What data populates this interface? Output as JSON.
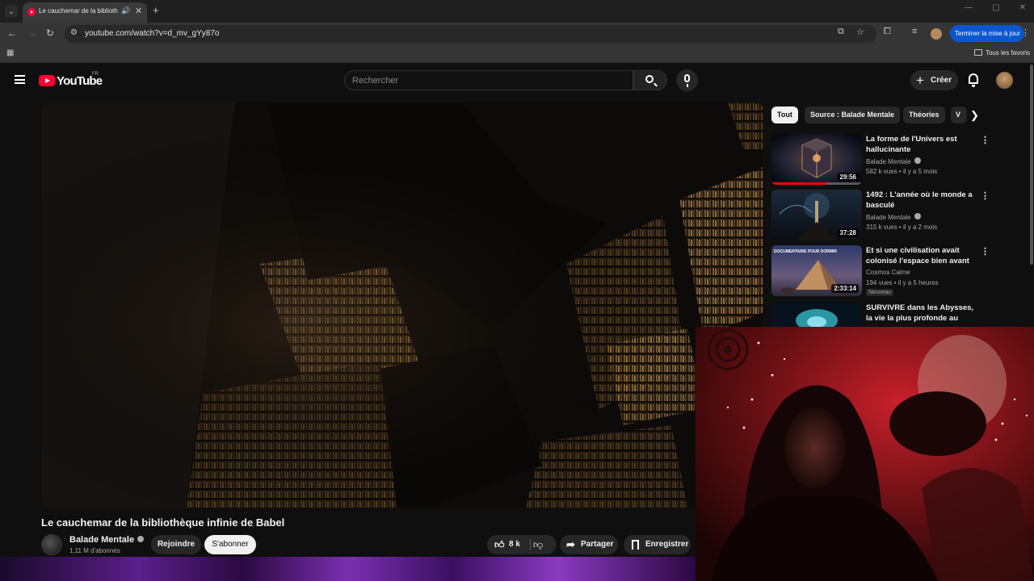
{
  "browser": {
    "tab_title": "Le cauchemar de la biblioth",
    "url": "youtube.com/watch?v=d_mv_gYy87o",
    "update_label": "Terminer la mise à jour",
    "all_favorites_label": "Tous les favoris"
  },
  "header": {
    "logo_text": "YouTube",
    "country_code": "FR",
    "search_placeholder": "Rechercher",
    "create_label": "Créer"
  },
  "video": {
    "title": "Le cauchemar de la bibliothèque infinie de Babel",
    "channel": "Balade Mentale",
    "subscribers": "1,11 M d'abonnés",
    "join_label": "Rejoindre",
    "subscribe_label": "S'abonner",
    "likes": "8 k",
    "share_label": "Partager",
    "save_label": "Enregistrer"
  },
  "chips": [
    "Tout",
    "Source : Balade Mentale",
    "Théories",
    "V"
  ],
  "recommendations": [
    {
      "title": "La forme de l'Univers est hallucinante",
      "channel": "Balade Mentale",
      "views": "582 k vues",
      "age": "il y a 5 mois",
      "duration": "29:56",
      "verified": true,
      "watched": 0.6
    },
    {
      "title": "1492 : L'année où le monde a basculé",
      "channel": "Balade Mentale",
      "views": "315 k vues",
      "age": "il y a 2 mois",
      "duration": "37:28",
      "verified": true
    },
    {
      "title": "Et si une civilisation avait colonisé l'espace bien avant ...",
      "channel": "Cosmos Calme",
      "views": "194 vues",
      "age": "il y a 5 heures",
      "duration": "2:33:14",
      "badge": "Nouveau",
      "thumb_text": "DOCUMENTAIRE POUR DORMIR"
    },
    {
      "title": "SURVIVRE dans les Abysses, la vie la plus profonde au monde",
      "channel": "",
      "views": "",
      "age": "",
      "duration": ""
    }
  ],
  "colors": {
    "accent": "#ff0033",
    "update_button": "#0b57d0",
    "background": "#0f0f0f"
  },
  "icons": [
    "search-icon",
    "mic-icon",
    "bell-icon",
    "like-icon",
    "dislike-icon",
    "share-icon",
    "save-icon",
    "hamburger-icon"
  ]
}
